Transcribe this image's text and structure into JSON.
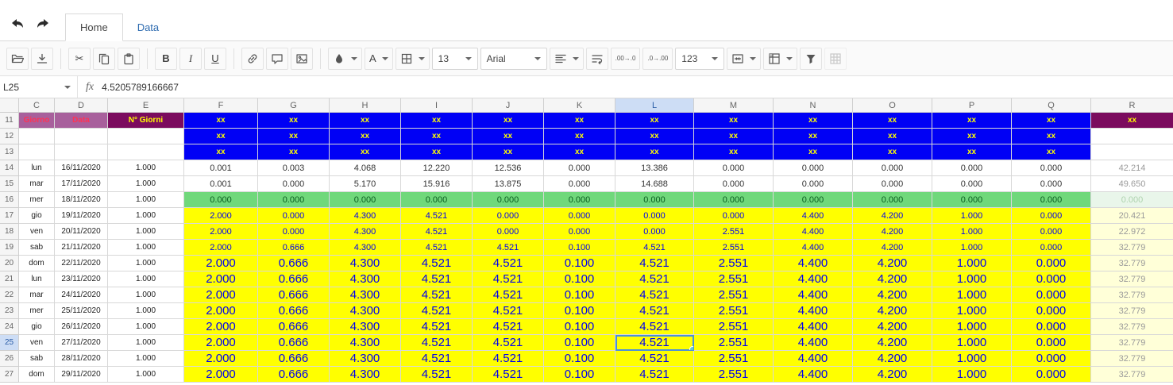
{
  "tabs": [
    {
      "label": "Home",
      "active": true
    },
    {
      "label": "Data",
      "active": false
    }
  ],
  "toolbar": {
    "bold": "B",
    "italic": "I",
    "underline": "U",
    "text_color": "A",
    "font_size": "13",
    "font_family": "Arial",
    "number_format": "123",
    "decrease_decimal": ".00→.0",
    "increase_decimal": ".0→.00"
  },
  "icons": {
    "cut": "✂"
  },
  "formula_bar": {
    "cell_ref": "L25",
    "fx_label": "fx",
    "value": "4.5205789166667"
  },
  "colors": {
    "blue_bg": "#0000f5",
    "blue_tx": "#ffff00",
    "plum_bg": "#a8609c",
    "plum_tx": "#ff3355",
    "maroon_bg": "#7b0b5e",
    "maroon_tx": "#ffff00",
    "green_bg": "#70d87b",
    "green_tx": "#0a5c20",
    "green_lt_bg": "#e9f6ea",
    "green_lt_tx": "#aed3ae",
    "yellow_bg": "#ffff00",
    "yellow_tx": "#0000f0",
    "yellow_lt_bg": "#ffffd8",
    "total_tx": "#9a9a9a",
    "sel_border": "#4a90d9",
    "sel_hdr": "#cdddf5"
  },
  "sheet": {
    "columns": [
      "C",
      "D",
      "E",
      "F",
      "G",
      "H",
      "I",
      "J",
      "K",
      "L",
      "M",
      "N",
      "O",
      "P",
      "Q",
      "R"
    ],
    "selected_cell": {
      "row": 25,
      "col": "L"
    },
    "rows": [
      {
        "n": 11,
        "style": "header",
        "day": "Giorno",
        "date": "Data",
        "giorni": "N° Giorni",
        "values": [
          "xx",
          "xx",
          "xx",
          "xx",
          "xx",
          "xx",
          "xx",
          "xx",
          "xx",
          "xx",
          "xx",
          "xx"
        ],
        "total": "xx"
      },
      {
        "n": 12,
        "style": "xx",
        "day": "",
        "date": "",
        "giorni": "",
        "values": [
          "xx",
          "xx",
          "xx",
          "xx",
          "xx",
          "xx",
          "xx",
          "xx",
          "xx",
          "xx",
          "xx",
          "xx"
        ],
        "total": ""
      },
      {
        "n": 13,
        "style": "xx",
        "day": "",
        "date": "",
        "giorni": "",
        "values": [
          "xx",
          "xx",
          "xx",
          "xx",
          "xx",
          "xx",
          "xx",
          "xx",
          "xx",
          "xx",
          "xx",
          "xx"
        ],
        "total": ""
      },
      {
        "n": 14,
        "style": "white",
        "day": "lun",
        "date": "16/11/2020",
        "giorni": "1.000",
        "values": [
          "0.001",
          "0.003",
          "4.068",
          "12.220",
          "12.536",
          "0.000",
          "13.386",
          "0.000",
          "0.000",
          "0.000",
          "0.000",
          "0.000"
        ],
        "total": "42.214"
      },
      {
        "n": 15,
        "style": "white",
        "day": "mar",
        "date": "17/11/2020",
        "giorni": "1.000",
        "values": [
          "0.001",
          "0.000",
          "5.170",
          "15.916",
          "13.875",
          "0.000",
          "14.688",
          "0.000",
          "0.000",
          "0.000",
          "0.000",
          "0.000"
        ],
        "total": "49.650"
      },
      {
        "n": 16,
        "style": "green",
        "day": "mer",
        "date": "18/11/2020",
        "giorni": "1.000",
        "values": [
          "0.000",
          "0.000",
          "0.000",
          "0.000",
          "0.000",
          "0.000",
          "0.000",
          "0.000",
          "0.000",
          "0.000",
          "0.000",
          "0.000"
        ],
        "total": "0.000"
      },
      {
        "n": 17,
        "style": "ysm",
        "day": "gio",
        "date": "19/11/2020",
        "giorni": "1.000",
        "values": [
          "2.000",
          "0.000",
          "4.300",
          "4.521",
          "0.000",
          "0.000",
          "0.000",
          "0.000",
          "4.400",
          "4.200",
          "1.000",
          "0.000"
        ],
        "total": "20.421"
      },
      {
        "n": 18,
        "style": "ysm",
        "day": "ven",
        "date": "20/11/2020",
        "giorni": "1.000",
        "values": [
          "2.000",
          "0.000",
          "4.300",
          "4.521",
          "0.000",
          "0.000",
          "0.000",
          "2.551",
          "4.400",
          "4.200",
          "1.000",
          "0.000"
        ],
        "total": "22.972"
      },
      {
        "n": 19,
        "style": "ysm",
        "day": "sab",
        "date": "21/11/2020",
        "giorni": "1.000",
        "values": [
          "2.000",
          "0.666",
          "4.300",
          "4.521",
          "4.521",
          "0.100",
          "4.521",
          "2.551",
          "4.400",
          "4.200",
          "1.000",
          "0.000"
        ],
        "total": "32.779"
      },
      {
        "n": 20,
        "style": "ylg",
        "day": "dom",
        "date": "22/11/2020",
        "giorni": "1.000",
        "values": [
          "2.000",
          "0.666",
          "4.300",
          "4.521",
          "4.521",
          "0.100",
          "4.521",
          "2.551",
          "4.400",
          "4.200",
          "1.000",
          "0.000"
        ],
        "total": "32.779"
      },
      {
        "n": 21,
        "style": "ylg",
        "day": "lun",
        "date": "23/11/2020",
        "giorni": "1.000",
        "values": [
          "2.000",
          "0.666",
          "4.300",
          "4.521",
          "4.521",
          "0.100",
          "4.521",
          "2.551",
          "4.400",
          "4.200",
          "1.000",
          "0.000"
        ],
        "total": "32.779"
      },
      {
        "n": 22,
        "style": "ylg",
        "day": "mar",
        "date": "24/11/2020",
        "giorni": "1.000",
        "values": [
          "2.000",
          "0.666",
          "4.300",
          "4.521",
          "4.521",
          "0.100",
          "4.521",
          "2.551",
          "4.400",
          "4.200",
          "1.000",
          "0.000"
        ],
        "total": "32.779"
      },
      {
        "n": 23,
        "style": "ylg",
        "day": "mer",
        "date": "25/11/2020",
        "giorni": "1.000",
        "values": [
          "2.000",
          "0.666",
          "4.300",
          "4.521",
          "4.521",
          "0.100",
          "4.521",
          "2.551",
          "4.400",
          "4.200",
          "1.000",
          "0.000"
        ],
        "total": "32.779"
      },
      {
        "n": 24,
        "style": "ylg",
        "day": "gio",
        "date": "26/11/2020",
        "giorni": "1.000",
        "values": [
          "2.000",
          "0.666",
          "4.300",
          "4.521",
          "4.521",
          "0.100",
          "4.521",
          "2.551",
          "4.400",
          "4.200",
          "1.000",
          "0.000"
        ],
        "total": "32.779"
      },
      {
        "n": 25,
        "style": "ylg",
        "day": "ven",
        "date": "27/11/2020",
        "giorni": "1.000",
        "values": [
          "2.000",
          "0.666",
          "4.300",
          "4.521",
          "4.521",
          "0.100",
          "4.521",
          "2.551",
          "4.400",
          "4.200",
          "1.000",
          "0.000"
        ],
        "total": "32.779"
      },
      {
        "n": 26,
        "style": "ylg",
        "day": "sab",
        "date": "28/11/2020",
        "giorni": "1.000",
        "values": [
          "2.000",
          "0.666",
          "4.300",
          "4.521",
          "4.521",
          "0.100",
          "4.521",
          "2.551",
          "4.400",
          "4.200",
          "1.000",
          "0.000"
        ],
        "total": "32.779"
      },
      {
        "n": 27,
        "style": "ylg",
        "day": "dom",
        "date": "29/11/2020",
        "giorni": "1.000",
        "values": [
          "2.000",
          "0.666",
          "4.300",
          "4.521",
          "4.521",
          "0.100",
          "4.521",
          "2.551",
          "4.400",
          "4.200",
          "1.000",
          "0.000"
        ],
        "total": "32.779"
      }
    ]
  }
}
